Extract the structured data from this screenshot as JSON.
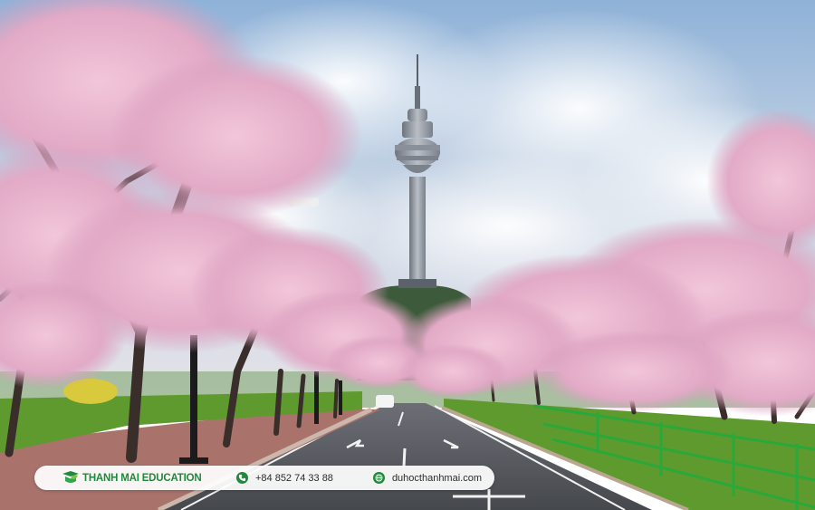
{
  "photo": {
    "subject": "cherry-blossom-avenue-with-tower",
    "colors": {
      "sky": "#c9d6e6",
      "blossom": "#e8b8cf",
      "hedge": "#5f9a2e",
      "road": "#5a5d63",
      "railing": "#2aa83a"
    }
  },
  "brand_bar": {
    "brand_name": "THANH MAI EDUCATION",
    "phone": "+84 852 74 33 88",
    "website": "duhocthanhmai.com",
    "accent": "#1f8a3b",
    "icons": [
      "logo-icon",
      "phone-icon",
      "globe-icon"
    ]
  }
}
